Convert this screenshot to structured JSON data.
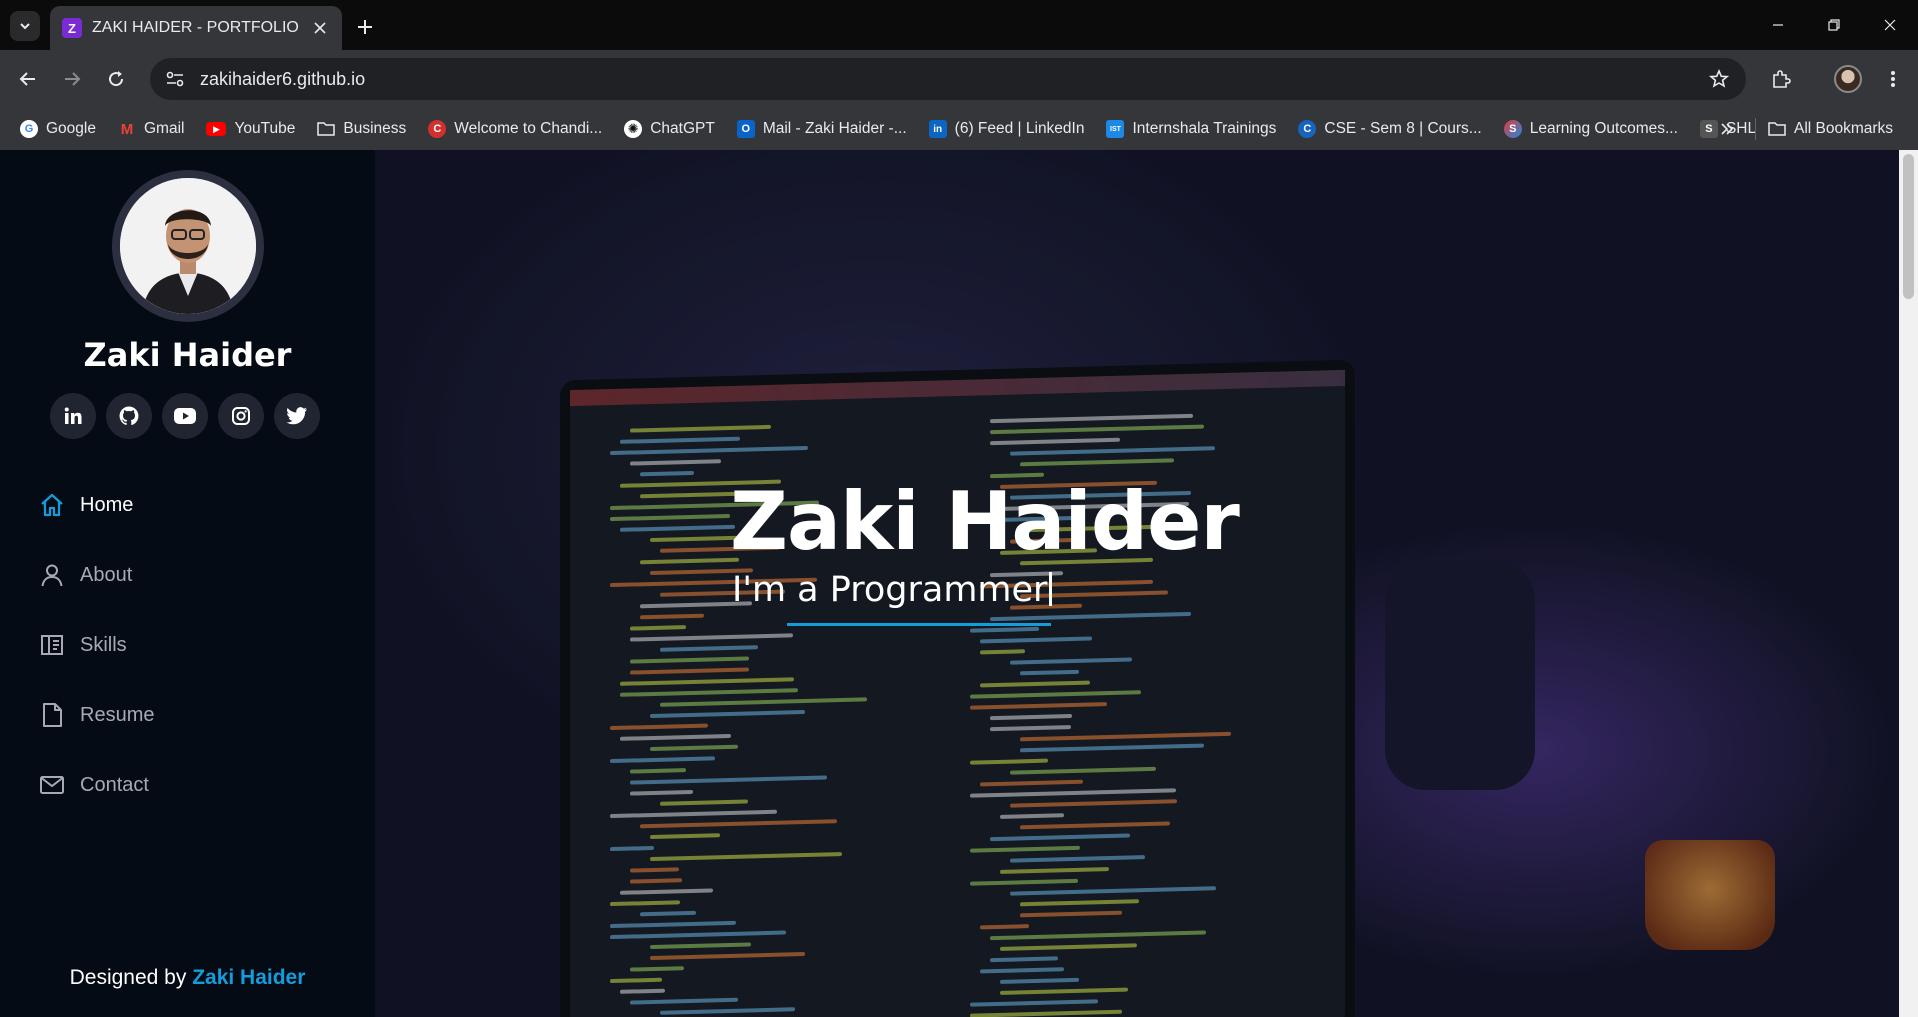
{
  "browser": {
    "tab_title": "ZAKI HAIDER - PORTFOLIO",
    "tab_favicon": "Z",
    "url": "zakihaider6.github.io",
    "bookmarks": [
      {
        "label": "Google",
        "icon": "google-icon",
        "color": "#4285f4",
        "glyph": "G"
      },
      {
        "label": "Gmail",
        "icon": "gmail-icon",
        "color": "#ea4335",
        "glyph": "M"
      },
      {
        "label": "YouTube",
        "icon": "youtube-icon",
        "color": "#ff0000",
        "glyph": "▶"
      },
      {
        "label": "Business",
        "icon": "folder-icon",
        "color": "",
        "glyph": ""
      },
      {
        "label": "Welcome to Chandi...",
        "icon": "chandigarh-icon",
        "color": "#d32f2f",
        "glyph": "C"
      },
      {
        "label": "ChatGPT",
        "icon": "chatgpt-icon",
        "color": "#3c3c3c",
        "glyph": "✺"
      },
      {
        "label": "Mail - Zaki Haider -...",
        "icon": "outlook-icon",
        "color": "#0a64c8",
        "glyph": "O"
      },
      {
        "label": "(6) Feed | LinkedIn",
        "icon": "linkedin-icon",
        "color": "#0a66c2",
        "glyph": "in"
      },
      {
        "label": "Internshala Trainings",
        "icon": "internshala-icon",
        "color": "#1e88e5",
        "glyph": "IST"
      },
      {
        "label": "CSE - Sem 8 | Cours...",
        "icon": "coursera-icon",
        "color": "#1565c0",
        "glyph": "C"
      },
      {
        "label": "Learning Outcomes...",
        "icon": "learning-icon",
        "color": "#e53935",
        "glyph": "S"
      },
      {
        "label": "SHL",
        "icon": "shl-icon",
        "color": "#555555",
        "glyph": "S"
      }
    ],
    "all_bookmarks": "All Bookmarks"
  },
  "sidebar": {
    "name": "Zaki Haider",
    "socials": [
      "linkedin-icon",
      "github-icon",
      "youtube-icon",
      "instagram-icon",
      "twitter-icon"
    ],
    "nav": [
      {
        "label": "Home",
        "icon": "home-icon",
        "active": true
      },
      {
        "label": "About",
        "icon": "user-icon",
        "active": false
      },
      {
        "label": "Skills",
        "icon": "book-icon",
        "active": false
      },
      {
        "label": "Resume",
        "icon": "file-icon",
        "active": false
      },
      {
        "label": "Contact",
        "icon": "envelope-icon",
        "active": false
      }
    ],
    "credit_prefix": "Designed by",
    "credit_name": "Zaki Haider"
  },
  "hero": {
    "title": "Zaki Haider",
    "subtitle": "I'm a Programmer"
  },
  "colors": {
    "accent": "#149ddd",
    "sidebar_bg": "#040b14"
  }
}
